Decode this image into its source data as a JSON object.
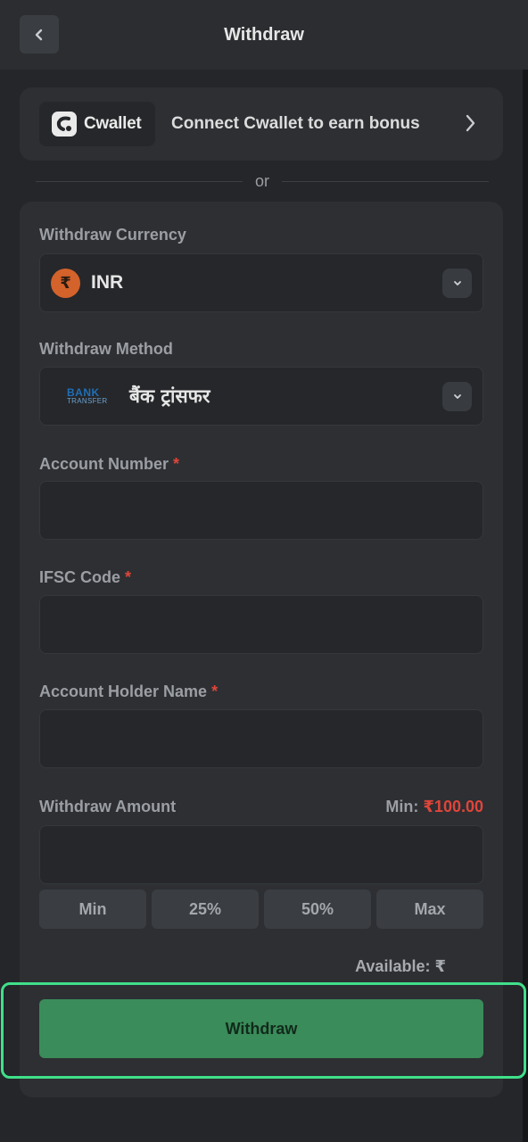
{
  "header": {
    "title": "Withdraw",
    "back_icon": "chevron-left-icon"
  },
  "cwallet": {
    "logo_text": "Cwallet",
    "text": "Connect Cwallet to earn bonus"
  },
  "divider_text": "or",
  "form": {
    "currency_label": "Withdraw Currency",
    "currency_value": "INR",
    "currency_symbol": "₹",
    "method_label": "Withdraw Method",
    "method_logo_top": "BANK",
    "method_logo_bottom": "TRANSFER",
    "method_value": "बैंक ट्रांसफर",
    "account_number_label": "Account Number",
    "ifsc_label": "IFSC Code",
    "holder_label": "Account Holder Name",
    "required_mark": "*",
    "amount_label": "Withdraw Amount",
    "min_prefix": "Min:",
    "min_value": "₹100.00",
    "quick_buttons": [
      "Min",
      "25%",
      "50%",
      "Max"
    ],
    "available": "Available: ₹",
    "submit_label": "Withdraw"
  },
  "colors": {
    "accent": "#3a8c5a",
    "highlight": "#3fe08a",
    "required": "#e0453a"
  }
}
